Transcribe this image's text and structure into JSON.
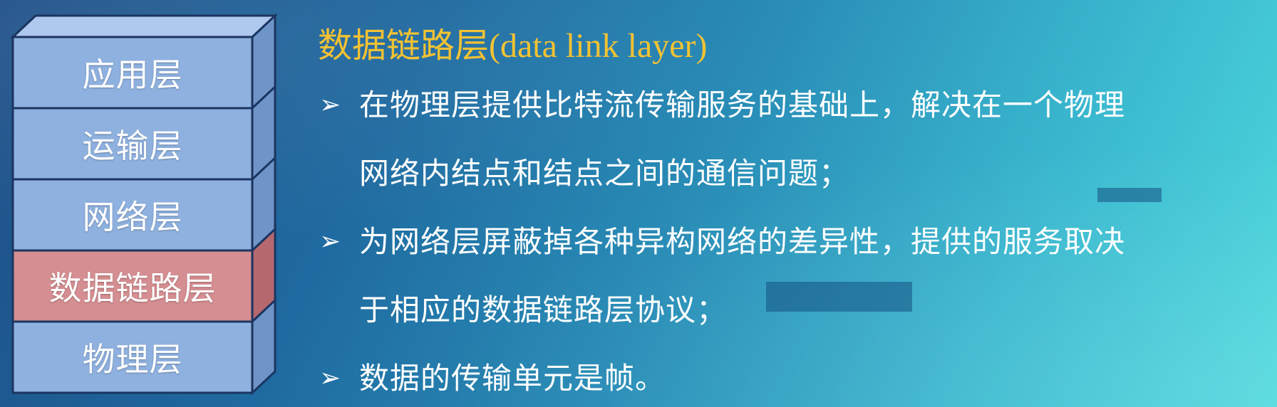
{
  "layers": {
    "items": [
      {
        "label": "应用层",
        "highlighted": false
      },
      {
        "label": "运输层",
        "highlighted": false
      },
      {
        "label": "网络层",
        "highlighted": false
      },
      {
        "label": "数据链路层",
        "highlighted": true
      },
      {
        "label": "物理层",
        "highlighted": false
      }
    ],
    "colors": {
      "front": "#8fb1df",
      "front_highlight": "#d58e91",
      "side": "#6f95c8",
      "side_highlight": "#b5696f",
      "top": "#aec8ee",
      "border": "#1b3560"
    }
  },
  "section": {
    "title": "数据链路层(data link layer)",
    "title_color": "#f3c233",
    "bullets": [
      {
        "line1": "在物理层提供比特流传输服务的基础上，解决在一个物理",
        "line2": "网络内结点和结点之间的通信问题；"
      },
      {
        "line1": "为网络层屏蔽掉各种异构网络的差异性，提供的服务取决",
        "line2": "于相应的数据链路层协议；"
      },
      {
        "line1": "数据的传输单元是帧。",
        "line2": ""
      }
    ],
    "bullet_icon": "arrow-right-icon"
  }
}
